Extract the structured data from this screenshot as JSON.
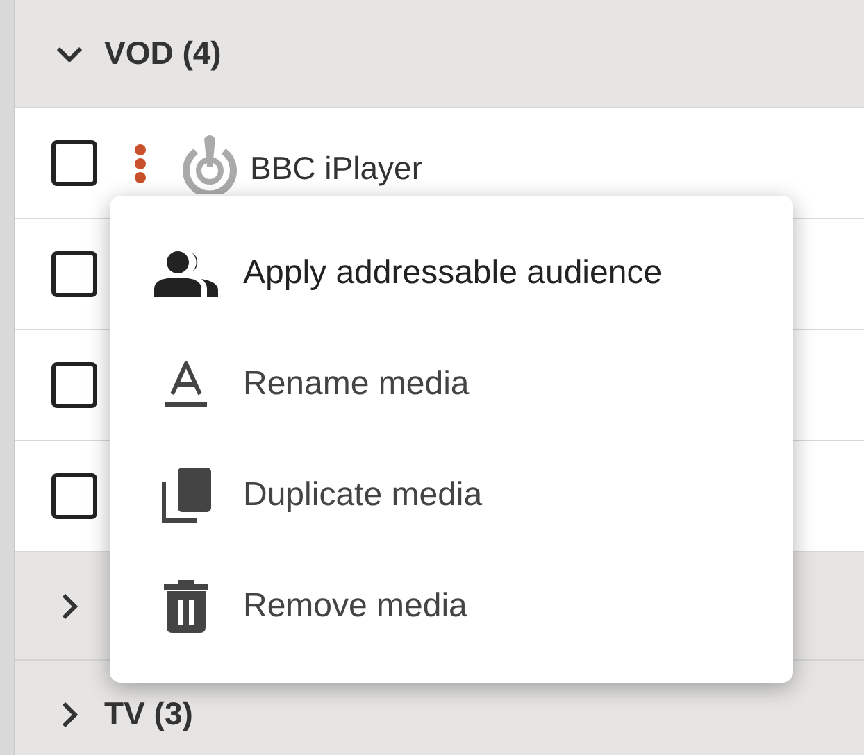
{
  "groups": [
    {
      "label": "VOD (4)",
      "expanded": true,
      "rows": [
        {
          "checked": false,
          "name": "BBC iPlayer"
        },
        {
          "checked": false
        },
        {
          "checked": false
        },
        {
          "checked": false
        }
      ]
    },
    {
      "expanded": false
    },
    {
      "label": "TV (3)",
      "expanded": false
    }
  ],
  "context_menu": {
    "items": [
      {
        "kind": "audience",
        "label": "Apply addressable audience"
      },
      {
        "kind": "rename",
        "label": "Rename media"
      },
      {
        "kind": "duplicate",
        "label": "Duplicate media"
      },
      {
        "kind": "remove",
        "label": "Remove media"
      }
    ]
  }
}
